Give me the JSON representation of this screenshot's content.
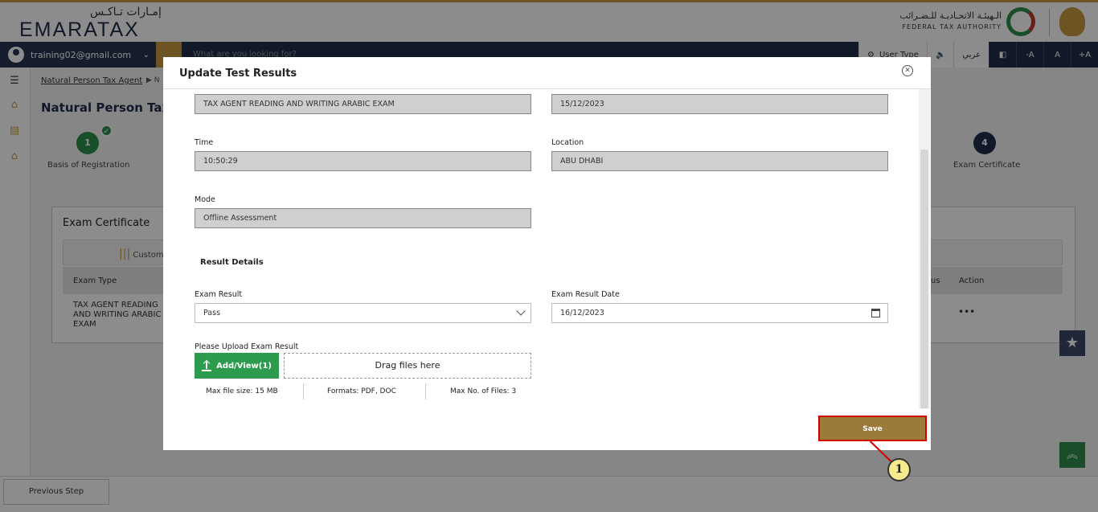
{
  "header": {
    "logo_ar": "إمـارات تـاكـس",
    "logo": "EMARATAX",
    "fta_ar": "الـهيئـة الاتحـاديـة للـضـرائب",
    "fta_en": "FEDERAL TAX AUTHORITY"
  },
  "navbar": {
    "user_email": "training02@gmail.com",
    "search_placeholder": "What are you looking for?",
    "user_type": "User Type",
    "lang": "عربي",
    "font_decrease": "-A",
    "font_normal": "A",
    "font_increase": "+A"
  },
  "breadcrumb": {
    "item1": "Natural Person Tax Agent",
    "item2": "N"
  },
  "page": {
    "title": "Natural Person Tax A",
    "steps": [
      {
        "number": "1",
        "label": "Basis of Registration"
      },
      {
        "number": "4",
        "label": "Exam Certificate"
      }
    ],
    "card_title": "Exam Certificate",
    "custom_label": "Custom",
    "table_headers": {
      "exam_type": "Exam Type",
      "status": "us",
      "action": "Action"
    },
    "table_row": {
      "exam_type": "TAX AGENT READING AND WRITING ARABIC EXAM",
      "action_dots": "•••"
    },
    "previous_step": "Previous Step"
  },
  "modal": {
    "title": "Update Test Results",
    "exam_name": "TAX AGENT READING AND WRITING ARABIC EXAM",
    "exam_date": "15/12/2023",
    "time_label": "Time",
    "time_value": "10:50:29",
    "location_label": "Location",
    "location_value": "ABU DHABI",
    "mode_label": "Mode",
    "mode_value": "Offline Assessment",
    "result_details": "Result Details",
    "exam_result_label": "Exam Result",
    "exam_result_value": "Pass",
    "exam_result_date_label": "Exam Result Date",
    "exam_result_date_value": "16/12/2023",
    "upload_label": "Please Upload Exam Result",
    "upload_button": "Add/View(1)",
    "drop_zone": "Drag files here",
    "max_size": "Max file size: 15 MB",
    "formats": "Formats: PDF, DOC",
    "max_files": "Max No. of Files: 3",
    "save": "Save"
  },
  "annotation": {
    "callout_number": "1"
  },
  "colors": {
    "navy": "#1f2d48",
    "gold": "#c69a3f",
    "green": "#2d9b4d",
    "save_brown": "#9b7a3a",
    "highlight_red": "#d40000"
  }
}
